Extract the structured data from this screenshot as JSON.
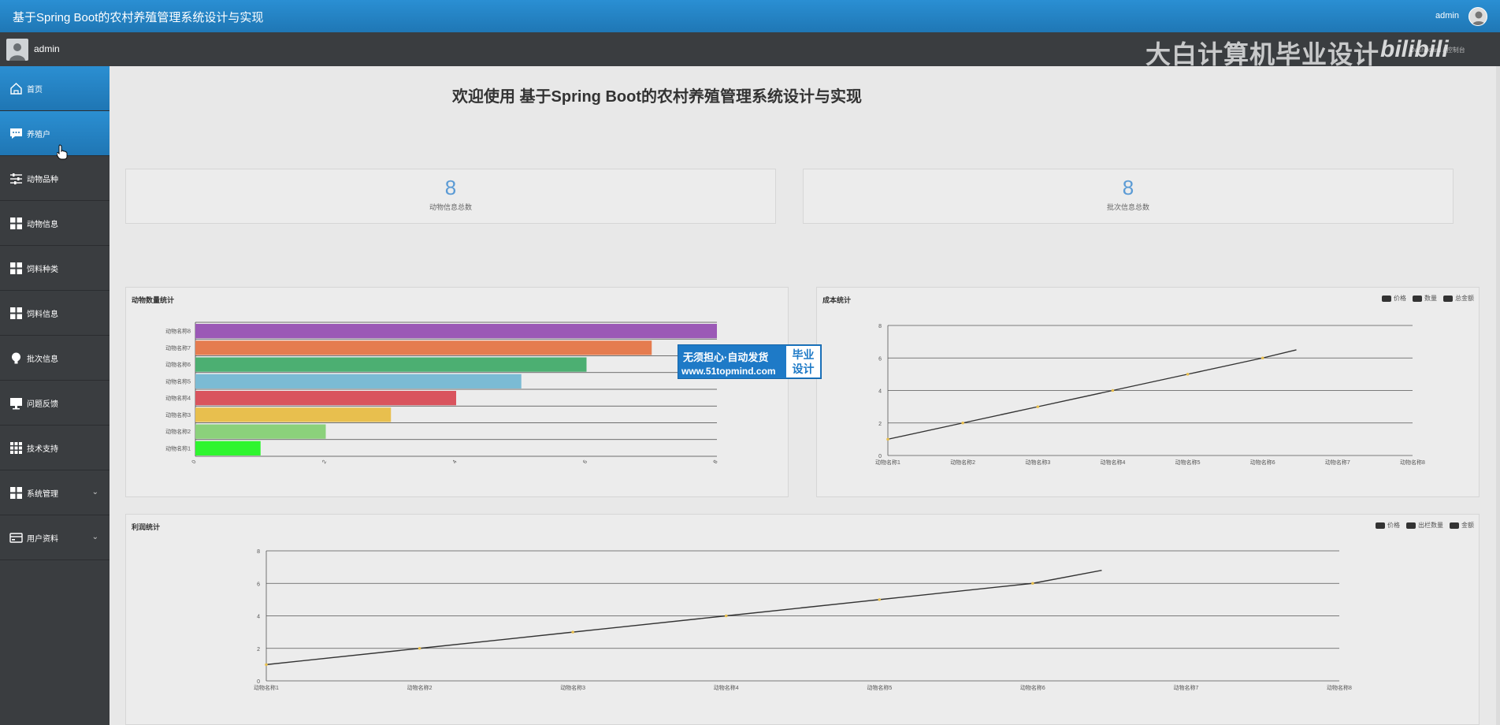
{
  "header": {
    "title": "基于Spring Boot的农村养殖管理系统设计与实现",
    "user": "admin"
  },
  "subheader": {
    "user": "admin",
    "watermark": "大白计算机毕业设计",
    "brand": "bilibili",
    "breadcrumb": "Dashboard / 控制台"
  },
  "sidebar": {
    "items": [
      {
        "label": "首页",
        "icon": "home-icon"
      },
      {
        "label": "养殖户",
        "icon": "chat-icon"
      },
      {
        "label": "动物品种",
        "icon": "sliders-icon"
      },
      {
        "label": "动物信息",
        "icon": "grid-icon"
      },
      {
        "label": "饲料种类",
        "icon": "grid-icon"
      },
      {
        "label": "饲料信息",
        "icon": "grid-icon"
      },
      {
        "label": "批次信息",
        "icon": "bulb-icon"
      },
      {
        "label": "问题反馈",
        "icon": "monitor-icon"
      },
      {
        "label": "技术支持",
        "icon": "apps-icon"
      },
      {
        "label": "系统管理",
        "icon": "grid-icon"
      },
      {
        "label": "用户资料",
        "icon": "card-icon"
      }
    ]
  },
  "welcome": "欢迎使用 基于Spring Boot的农村养殖管理系统设计与实现",
  "stats": [
    {
      "value": "8",
      "label": "动物信息总数"
    },
    {
      "value": "8",
      "label": "批次信息总数"
    }
  ],
  "ad": {
    "line1": "无须担心·自动发货",
    "line2": "www.51topmind.com",
    "right1": "毕业",
    "right2": "设计"
  },
  "colors": {
    "accent": "#1f77b5",
    "sidebar": "#3a3d40",
    "stat_number": "#5b9bd5"
  },
  "chart_data": [
    {
      "type": "bar",
      "title": "动物数量统计",
      "orientation": "horizontal",
      "categories": [
        "动物名称8",
        "动物名称7",
        "动物名称6",
        "动物名称5",
        "动物名称4",
        "动物名称3",
        "动物名称2",
        "动物名称1"
      ],
      "values": [
        8,
        7,
        6,
        5,
        4,
        3,
        2,
        1
      ],
      "colors": [
        "#9b59b6",
        "#e57c4f",
        "#4caf72",
        "#7bbbd4",
        "#d9545e",
        "#e8bf4e",
        "#8bd17b",
        "#2ff52f"
      ],
      "xticks": [
        "0",
        "2",
        "4",
        "6",
        "8"
      ],
      "xlim": [
        0,
        8
      ]
    },
    {
      "type": "line",
      "title": "成本统计",
      "legend": [
        "价格",
        "数量",
        "总金额"
      ],
      "legend_position": "top-right",
      "categories": [
        "动物名称1",
        "动物名称2",
        "动物名称3",
        "动物名称4",
        "动物名称5",
        "动物名称6",
        "动物名称7",
        "动物名称8"
      ],
      "values": [
        1,
        2,
        3,
        4,
        5,
        6
      ],
      "end_value": 6.5,
      "yticks": [
        "0",
        "2",
        "4",
        "6",
        "8"
      ],
      "ylim": [
        0,
        8
      ]
    },
    {
      "type": "line",
      "title": "利润统计",
      "legend": [
        "价格",
        "出栏数量",
        "金额"
      ],
      "legend_position": "top-right",
      "categories": [
        "动物名称1",
        "动物名称2",
        "动物名称3",
        "动物名称4",
        "动物名称5",
        "动物名称6",
        "动物名称7",
        "动物名称8"
      ],
      "values": [
        1,
        2,
        3,
        4,
        5,
        6
      ],
      "end_value": 6.8,
      "yticks": [
        "0",
        "2",
        "4",
        "6",
        "8"
      ],
      "ylim": [
        0,
        8
      ]
    }
  ]
}
